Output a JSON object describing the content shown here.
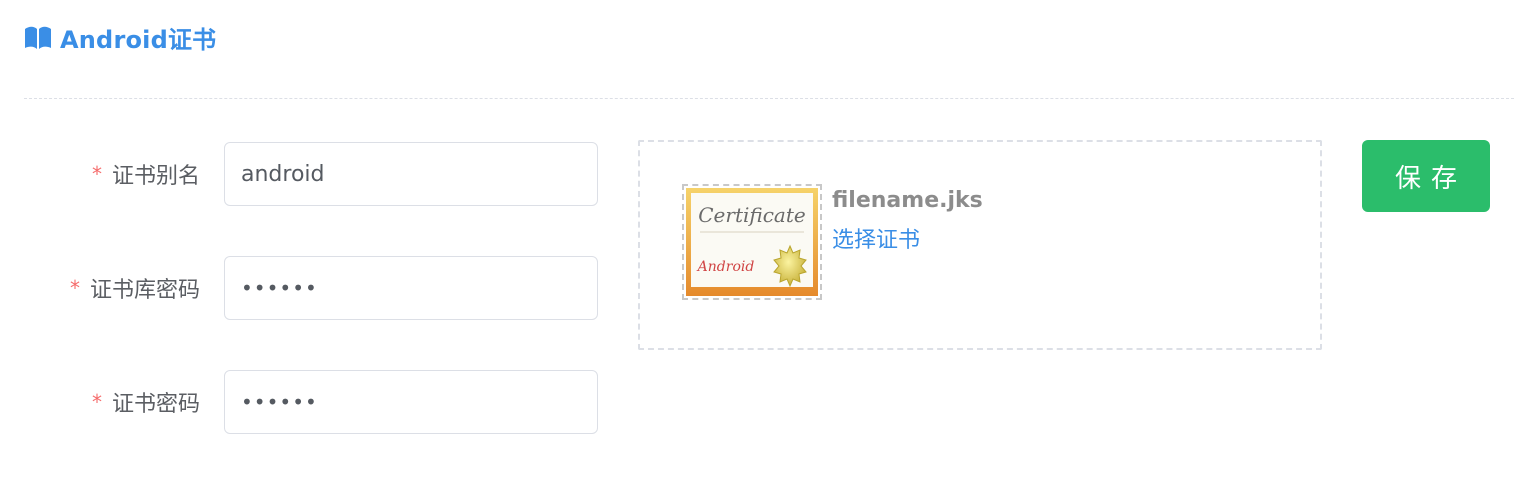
{
  "header": {
    "title": "Android证书",
    "icon": "book-icon",
    "color": "#3a8ee6"
  },
  "form": {
    "required_mark": "*",
    "fields": [
      {
        "label": "证书别名",
        "value": "android",
        "type": "text"
      },
      {
        "label": "证书库密码",
        "value": "••••••",
        "type": "password"
      },
      {
        "label": "证书密码",
        "value": "••••••",
        "type": "password"
      }
    ]
  },
  "upload": {
    "thumbnail": "certificate-icon",
    "thumbnail_text": "Certificate",
    "thumbnail_signature": "Android",
    "file_name": "filename.jks",
    "choose_label": "选择证书"
  },
  "actions": {
    "save_label": "保存",
    "save_color": "#2bbd6b"
  }
}
